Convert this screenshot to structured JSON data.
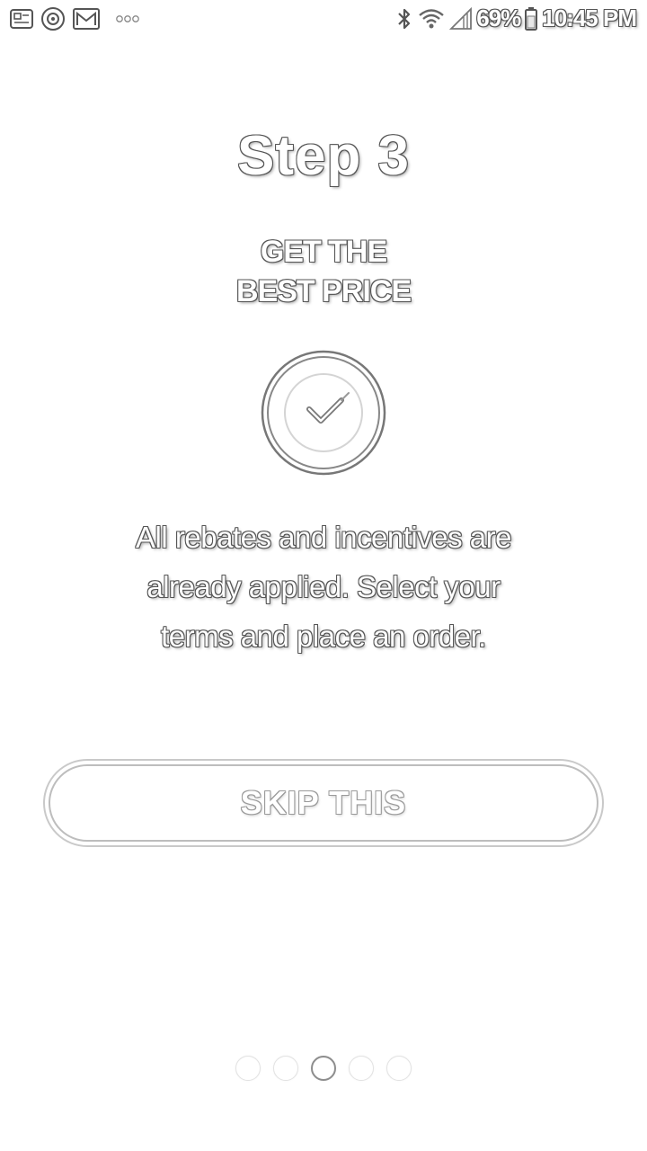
{
  "status_bar": {
    "left_icons": [
      "gallery-notification-icon",
      "target-notification-icon",
      "gmail-notification-icon",
      "more-notifications-icon"
    ],
    "right_icons": [
      "bluetooth-icon",
      "wifi-icon",
      "cell-signal-icon",
      "battery-icon"
    ],
    "battery_percent": "69%",
    "time": "10:45 PM"
  },
  "onboarding": {
    "step_title": "Step 3",
    "subtitle_line1": "GET THE",
    "subtitle_line2": "BEST PRICE",
    "badge_icon": "checkmark-circle-icon",
    "description_line1": "All rebates and incentives are",
    "description_line2": "already applied. Select your",
    "description_line3": "terms and place an order.",
    "skip_label": "SKIP THIS"
  },
  "pager": {
    "total_pages": 5,
    "current_page": 3
  }
}
